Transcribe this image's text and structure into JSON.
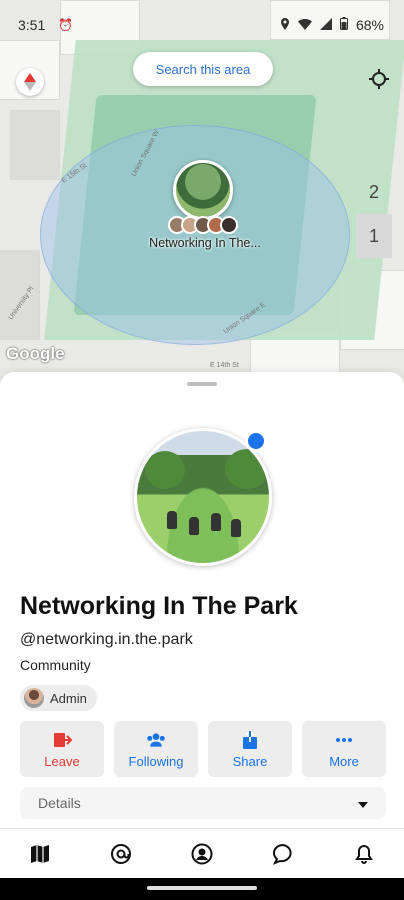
{
  "status_bar": {
    "time": "3:51",
    "battery": "68%"
  },
  "map": {
    "search_button": "Search this area",
    "marker_label": "Networking In The...",
    "floors": [
      "2",
      "1"
    ],
    "attribution": "Google",
    "street_labels": [
      "E 15th St",
      "Union Square W",
      "University Pl",
      "Union Square E",
      "E 14th St"
    ]
  },
  "group": {
    "name": "Networking In The Park",
    "handle": "@networking.in.the.park",
    "type": "Community",
    "role_chip": "Admin"
  },
  "actions": [
    {
      "label": "Leave",
      "icon": "leave-icon",
      "color": "#e53935"
    },
    {
      "label": "Following",
      "icon": "people-icon",
      "color": "#1a73e8"
    },
    {
      "label": "Share",
      "icon": "share-icon",
      "color": "#1a73e8"
    },
    {
      "label": "More",
      "icon": "more-icon",
      "color": "#1a73e8"
    }
  ],
  "details": {
    "label": "Details"
  },
  "bottom_nav": [
    "map-icon",
    "at-icon",
    "profile-icon",
    "chat-icon",
    "bell-icon"
  ],
  "colors": {
    "accent": "#1a73e8",
    "danger": "#e53935"
  }
}
